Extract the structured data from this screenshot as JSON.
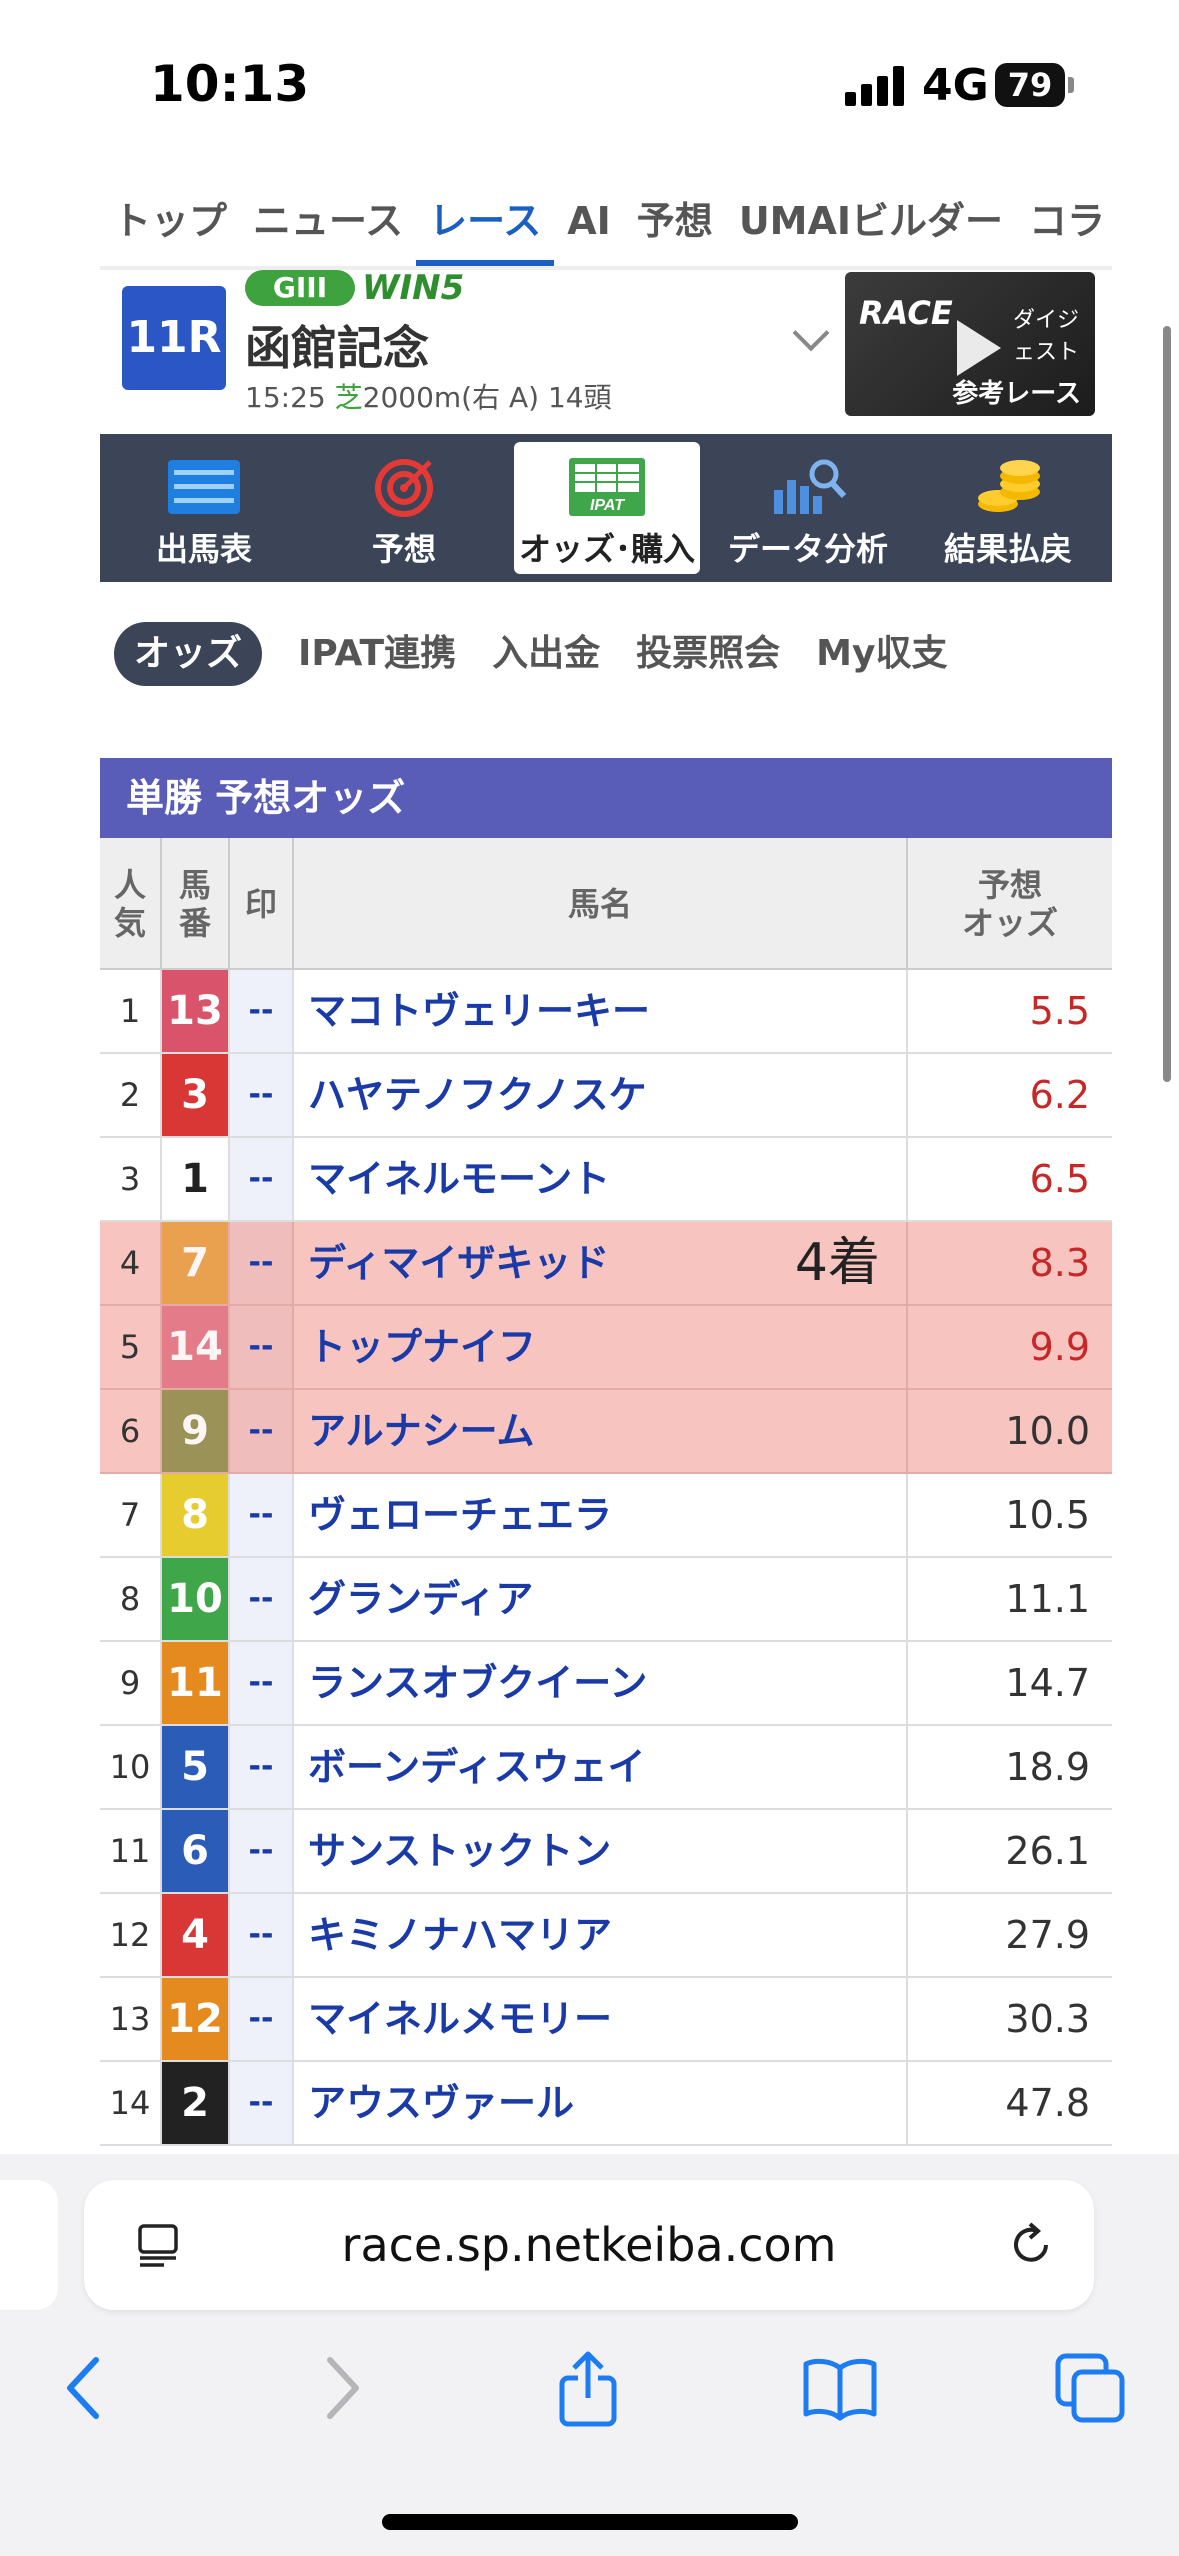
{
  "status": {
    "time": "10:13",
    "network": "4G",
    "battery": "79"
  },
  "nav_tabs": [
    "トップ",
    "ニュース",
    "レース",
    "AI",
    "予想",
    "UMAIビルダー",
    "コラ"
  ],
  "nav_active_index": 2,
  "race": {
    "number": "11R",
    "grade": "GIII",
    "win5": "WIN5",
    "name": "函館記念",
    "info_time": "15:25",
    "info_surface": "芝",
    "info_rest": "2000m(右 A) 14頭",
    "thumb_brand": "RACE",
    "thumb_sub": "ダイジェスト",
    "thumb_caption": "参考レース"
  },
  "menu": [
    {
      "label": "出馬表",
      "icon": "list-icon"
    },
    {
      "label": "予想",
      "icon": "target-icon"
    },
    {
      "label": "オッズ･購入",
      "icon": "ipat-icon"
    },
    {
      "label": "データ分析",
      "icon": "chart-search-icon"
    },
    {
      "label": "結果払戻",
      "icon": "coins-icon"
    }
  ],
  "subtabs": [
    "オッズ",
    "IPAT連携",
    "入出金",
    "投票照会",
    "My収支"
  ],
  "table": {
    "title": "単勝 予想オッズ",
    "headers": {
      "popularity": "人\n気",
      "horse_num": "馬\n番",
      "mark": "印",
      "name": "馬名",
      "odds": "予想\nオッズ"
    },
    "rows": [
      {
        "pop": "1",
        "num": "13",
        "color": "#d9536a",
        "mark": "--",
        "name": "マコトヴェリーキー",
        "odds": "5.5",
        "red": true,
        "hl": false,
        "note": ""
      },
      {
        "pop": "2",
        "num": "3",
        "color": "#d93636",
        "mark": "--",
        "name": "ハヤテノフクノスケ",
        "odds": "6.2",
        "red": true,
        "hl": false,
        "note": ""
      },
      {
        "pop": "3",
        "num": "1",
        "color": "#ffffff",
        "mark": "--",
        "name": "マイネルモーント",
        "odds": "6.5",
        "red": true,
        "hl": false,
        "note": ""
      },
      {
        "pop": "4",
        "num": "7",
        "color": "#e89b3c",
        "mark": "--",
        "name": "ディマイザキッド",
        "odds": "8.3",
        "red": true,
        "hl": true,
        "note": "4着"
      },
      {
        "pop": "5",
        "num": "14",
        "color": "#e0707f",
        "mark": "--",
        "name": "トップナイフ",
        "odds": "9.9",
        "red": true,
        "hl": true,
        "note": ""
      },
      {
        "pop": "6",
        "num": "9",
        "color": "#8a8a44",
        "mark": "--",
        "name": "アルナシーム",
        "odds": "10.0",
        "red": false,
        "hl": true,
        "note": ""
      },
      {
        "pop": "7",
        "num": "8",
        "color": "#e6cc2e",
        "mark": "--",
        "name": "ヴェローチェエラ",
        "odds": "10.5",
        "red": false,
        "hl": false,
        "note": ""
      },
      {
        "pop": "8",
        "num": "10",
        "color": "#3fa649",
        "mark": "--",
        "name": "グランディア",
        "odds": "11.1",
        "red": false,
        "hl": false,
        "note": ""
      },
      {
        "pop": "9",
        "num": "11",
        "color": "#e48a1f",
        "mark": "--",
        "name": "ランスオブクイーン",
        "odds": "14.7",
        "red": false,
        "hl": false,
        "note": ""
      },
      {
        "pop": "10",
        "num": "5",
        "color": "#2a5cb8",
        "mark": "--",
        "name": "ボーンディスウェイ",
        "odds": "18.9",
        "red": false,
        "hl": false,
        "note": ""
      },
      {
        "pop": "11",
        "num": "6",
        "color": "#2a5cb8",
        "mark": "--",
        "name": "サンストックトン",
        "odds": "26.1",
        "red": false,
        "hl": false,
        "note": ""
      },
      {
        "pop": "12",
        "num": "4",
        "color": "#d93636",
        "mark": "--",
        "name": "キミノナハマリア",
        "odds": "27.9",
        "red": false,
        "hl": false,
        "note": ""
      },
      {
        "pop": "13",
        "num": "12",
        "color": "#e48a1f",
        "mark": "--",
        "name": "マイネルメモリー",
        "odds": "30.3",
        "red": false,
        "hl": false,
        "note": ""
      },
      {
        "pop": "14",
        "num": "2",
        "color": "#222222",
        "mark": "--",
        "name": "アウスヴァール",
        "odds": "47.8",
        "red": false,
        "hl": false,
        "note": ""
      }
    ]
  },
  "browser": {
    "url": "race.sp.netkeiba.com"
  }
}
